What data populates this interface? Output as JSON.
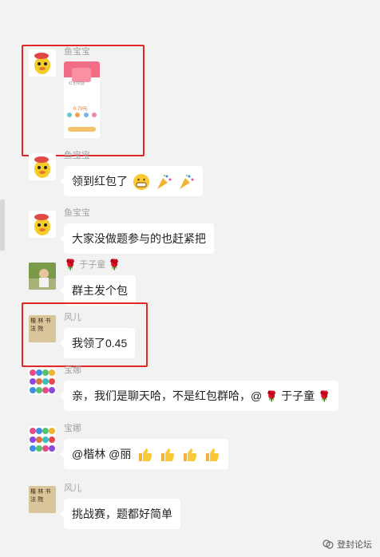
{
  "messages": [
    {
      "name": "鱼宝宝",
      "type": "image",
      "image_title": "红包奖励",
      "image_amount": "0.79元"
    },
    {
      "name": "鱼宝宝",
      "text": "领到红包了"
    },
    {
      "name": "鱼宝宝",
      "text": "大家没做题参与的也赶紧把"
    },
    {
      "name": "于子童",
      "text": "群主发个包"
    },
    {
      "name": "风儿",
      "text": "我领了0.45"
    },
    {
      "name": "宝娜",
      "text_before": "亲，我们是聊天哈，不是红包群哈，@",
      "text_mention": "于子童"
    },
    {
      "name": "宝娜",
      "text_before": "@楷林 @丽"
    },
    {
      "name": "风儿",
      "text": "挑战赛，题都好简单"
    }
  ],
  "avatars": {
    "fengr_calligraphy": "楷 林 书 法 院"
  },
  "watermark": "登封论坛"
}
